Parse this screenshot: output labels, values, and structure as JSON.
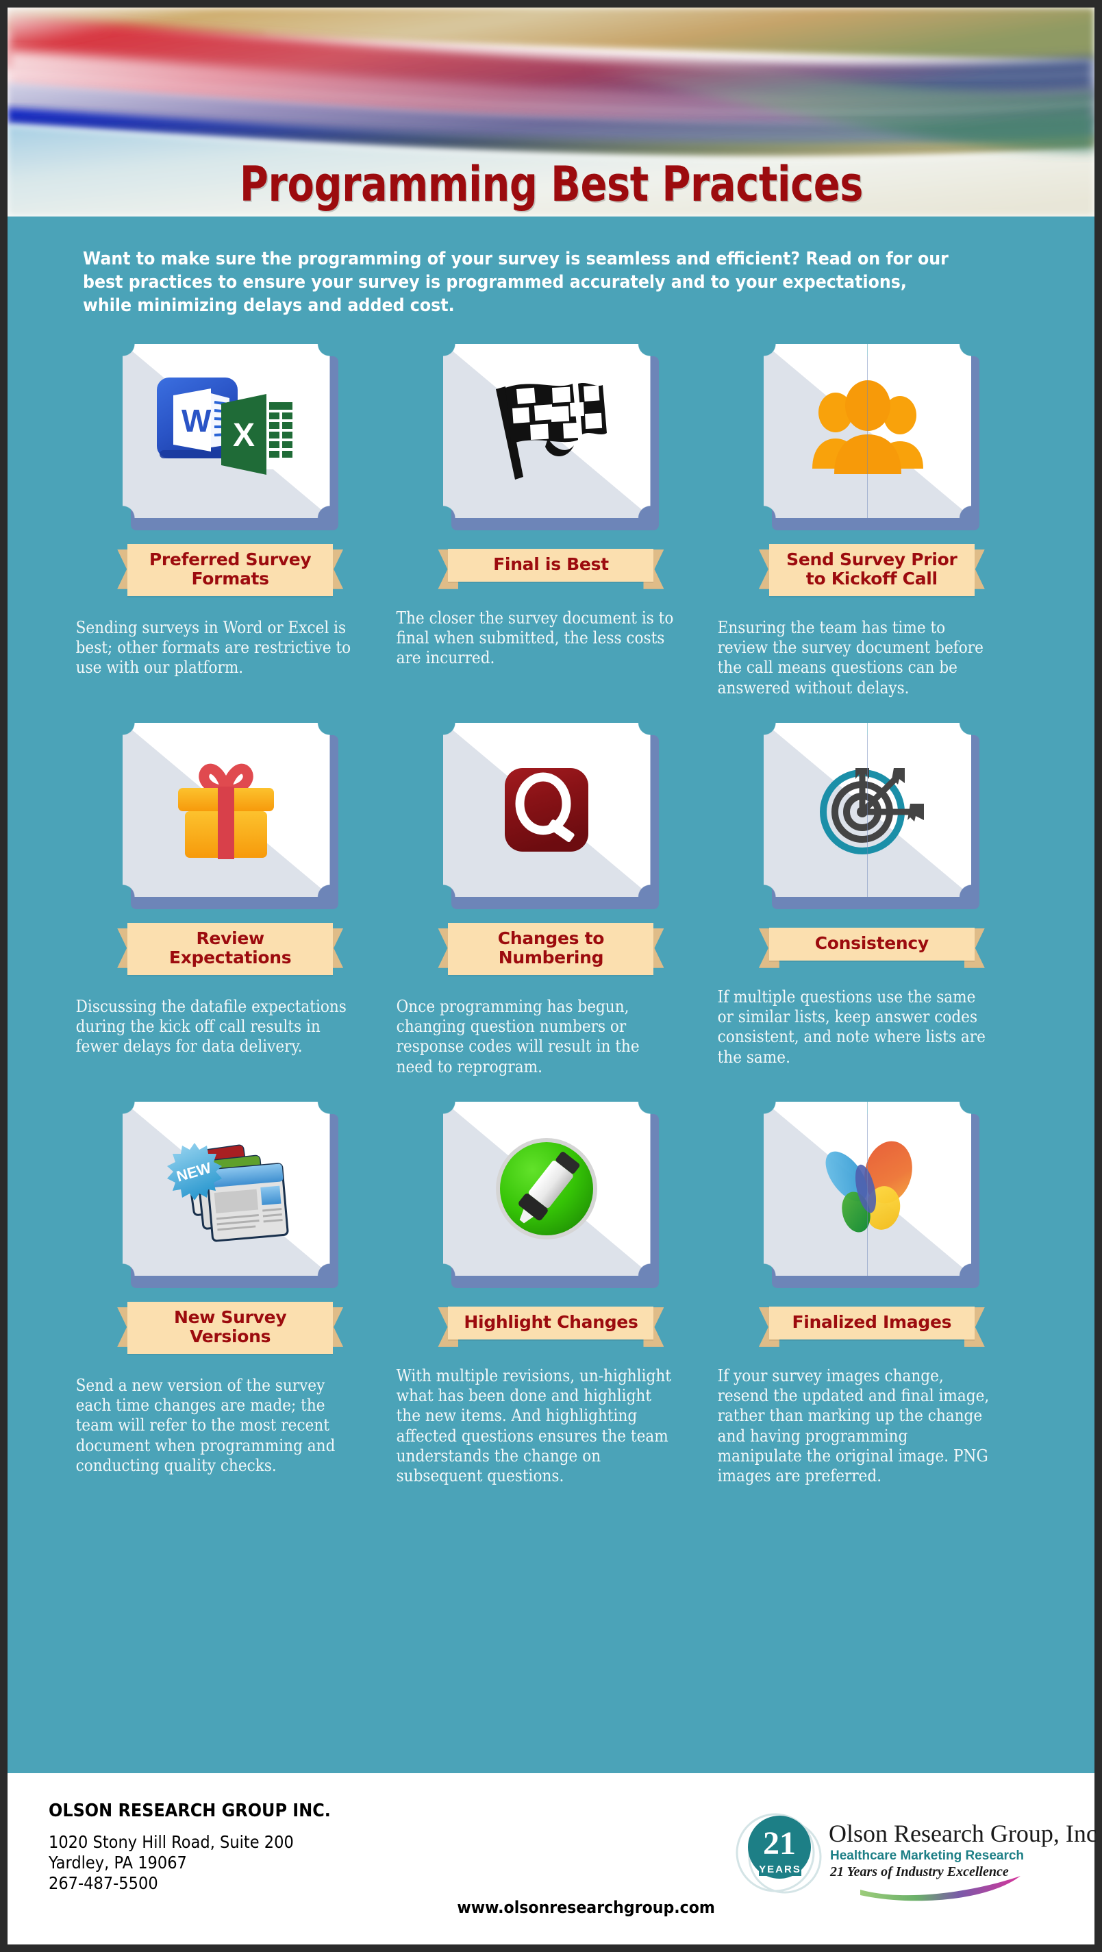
{
  "header": {
    "title": "Programming Best Practices"
  },
  "intro": {
    "text": "Want to make sure the programming of your survey is seamless and efficient? Read on for our best practices to ensure your survey is programmed accurately and to your expectations, while minimizing delays and added cost."
  },
  "cards": [
    {
      "icon": "word-excel-documents-icon",
      "label": "Preferred Survey\nFormats",
      "description": "Sending surveys in Word or Excel is best; other formats are restrictive to use with our platform."
    },
    {
      "icon": "checkered-flag-icon",
      "label": "Final is Best",
      "description": "The closer the survey document is to final when submitted, the less costs are incurred."
    },
    {
      "icon": "group-of-people-icon",
      "label": "Send Survey Prior to\nKickoff Call",
      "description": "Ensuring the team has time to review the survey document before the call means questions can be answered without delays."
    },
    {
      "icon": "gift-box-icon",
      "label": "Review\nExpectations",
      "description": "Discussing the datafile expectations during the kick off call results in fewer delays for data delivery."
    },
    {
      "icon": "question-q-badge-icon",
      "label": "Changes to\nNumbering",
      "description": "Once programming has begun, changing question numbers or response codes will result in the need to reprogram."
    },
    {
      "icon": "target-with-arrows-icon",
      "label": "Consistency",
      "description": "If multiple questions use the same or similar lists, keep answer codes consistent, and note where lists are the same."
    },
    {
      "icon": "new-documents-stack-icon",
      "label": "New Survey\nVersions",
      "description": "Send a new version of the survey each time changes are made; the team will refer to the most recent document when programming and conducting quality checks."
    },
    {
      "icon": "highlighter-marker-icon",
      "label": "Highlight Changes",
      "description": "With multiple revisions, un-highlight what has been done and highlight the new items. And highlighting affected questions ensures the team understands the change on subsequent questions."
    },
    {
      "icon": "colorful-butterfly-icon",
      "label": "Finalized Images",
      "description": "If your survey images change, resend the updated and final image, rather than marking up the change and having programming manipulate the original image. PNG images are preferred."
    }
  ],
  "footer": {
    "company": "OLSON RESEARCH GROUP INC.",
    "address_line1": "1020 Stony Hill Road, Suite 200",
    "address_line2": "Yardley, PA  19067",
    "phone": "267-487-5500",
    "website": "www.olsonresearchgroup.com",
    "logo": {
      "badge_number": "21",
      "badge_years": "YEARS",
      "name": "Olson Research Group, Inc.",
      "tagline": "Healthcare Marketing Research",
      "subtagline": "21 Years of Industry Excellence"
    }
  },
  "colors": {
    "background_teal": "#4ba3b8",
    "title_red": "#9c0b0e",
    "ribbon_cream": "#fbdfaf",
    "ribbon_tail": "#dfbc88",
    "card_shadow_blue": "#6d85b8",
    "card_diagonal_gray": "#dde2ea"
  }
}
